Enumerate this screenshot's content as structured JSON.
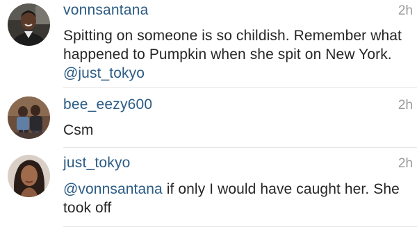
{
  "comments": [
    {
      "username": "vonnsantana",
      "time": "2h",
      "text_before": "Spitting on someone  is so childish.  Remember what happened to Pumpkin when she spit on New York.  ",
      "mention": "@just_tokyo",
      "text_after": "",
      "avatar": "profile-photo"
    },
    {
      "username": "bee_eezy600",
      "time": "2h",
      "text_before": "Csm",
      "mention": "",
      "text_after": "",
      "avatar": "profile-photo"
    },
    {
      "username": "just_tokyo",
      "time": "2h",
      "text_before": "",
      "mention": "@vonnsantana",
      "text_after": " if only I would have caught her. She took off",
      "avatar": "profile-photo"
    }
  ],
  "colors": {
    "username": "#2b5b84",
    "mention": "#2b5b84",
    "text": "#262626",
    "time": "#9a9a9a",
    "divider": "#e6e6e6"
  }
}
